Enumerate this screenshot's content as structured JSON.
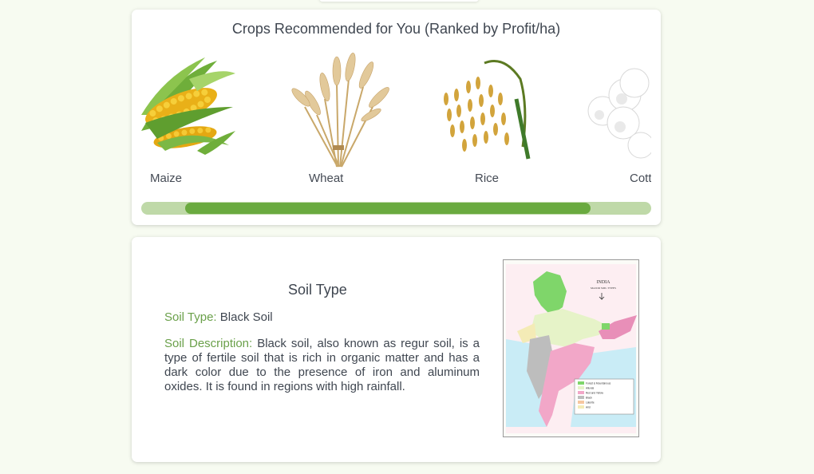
{
  "crops": {
    "title": "Crops Recommended for You (Ranked by Profit/ha)",
    "items": [
      {
        "label": "Maize",
        "icon": "maize-image"
      },
      {
        "label": "Wheat",
        "icon": "wheat-image"
      },
      {
        "label": "Rice",
        "icon": "rice-image"
      },
      {
        "label": "Cott",
        "icon": "cotton-image"
      }
    ],
    "scroll_position": 0.53
  },
  "soil": {
    "title": "Soil Type",
    "type_label": "Soil Type:",
    "type_value": "Black Soil",
    "description_label": "Soil Description:",
    "description_value": "Black soil, also known as regur soil, is a type of fertile soil that is rich in organic matter and has a dark color due to the presence of iron and aluminum oxides. It is found in regions with high rainfall.",
    "map": {
      "title": "INDIA",
      "subtitle": "MAJOR SOIL TYPES",
      "legend": [
        "Forest & Mountainous",
        "Alluvial",
        "Red and Yellow",
        "Black",
        "Laterite",
        "Arid"
      ]
    }
  },
  "colors": {
    "accent": "#6aaa3f",
    "accent_light": "#bfd9a8",
    "label_green": "#6aa04a",
    "background": "#f7fbf1"
  }
}
